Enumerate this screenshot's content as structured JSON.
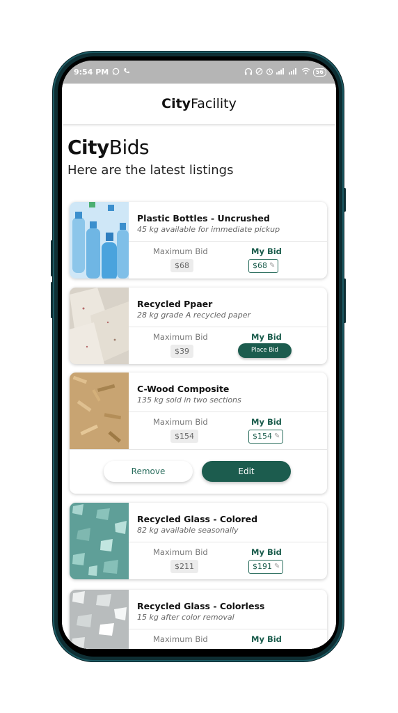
{
  "status_bar": {
    "time": "9:54 PM",
    "left_icons": [
      "whatsapp-icon",
      "phone-call-icon"
    ],
    "right_icons": [
      "headphones-icon",
      "dnd-icon",
      "alarm-icon",
      "signal-icon",
      "signal-icon",
      "wifi-icon"
    ],
    "battery": "56"
  },
  "header": {
    "title_bold": "City",
    "title_rest": "Facility"
  },
  "page": {
    "title_bold": "City",
    "title_rest": "Bids",
    "subtitle": "Here are the latest listings"
  },
  "listings": [
    {
      "title": "Plastic Bottles - Uncrushed",
      "description": "45 kg available for immediate pickup",
      "max_bid_label": "Maximum Bid",
      "max_bid": "$68",
      "my_bid_label": "My Bid",
      "my_bid": "$68",
      "image": "plastic-bottles-image"
    },
    {
      "title": "Recycled Ppaer",
      "description": "28 kg grade A recycled paper",
      "max_bid_label": "Maximum Bid",
      "max_bid": "$39",
      "my_bid_label": "My Bid",
      "place_bid_label": "Place Bid",
      "image": "recycled-paper-image"
    },
    {
      "title": "C-Wood Composite",
      "description": "135 kg sold in two sections",
      "max_bid_label": "Maximum Bid",
      "max_bid": "$154",
      "my_bid_label": "My Bid",
      "my_bid": "$154",
      "remove_label": "Remove",
      "edit_label": "Edit",
      "image": "wood-composite-image"
    },
    {
      "title": "Recycled Glass - Colored",
      "description": "82 kg available seasonally",
      "max_bid_label": "Maximum Bid",
      "max_bid": "$211",
      "my_bid_label": "My Bid",
      "my_bid": "$191",
      "image": "colored-glass-image"
    },
    {
      "title": "Recycled Glass - Colorless",
      "description": "15 kg after color removal",
      "max_bid_label": "Maximum Bid",
      "my_bid_label": "My Bid",
      "image": "colorless-glass-image"
    }
  ],
  "colors": {
    "brand": "#1c5c4e",
    "status_bar": "#b5b5b5",
    "phone_frame": "#0e2e33"
  }
}
